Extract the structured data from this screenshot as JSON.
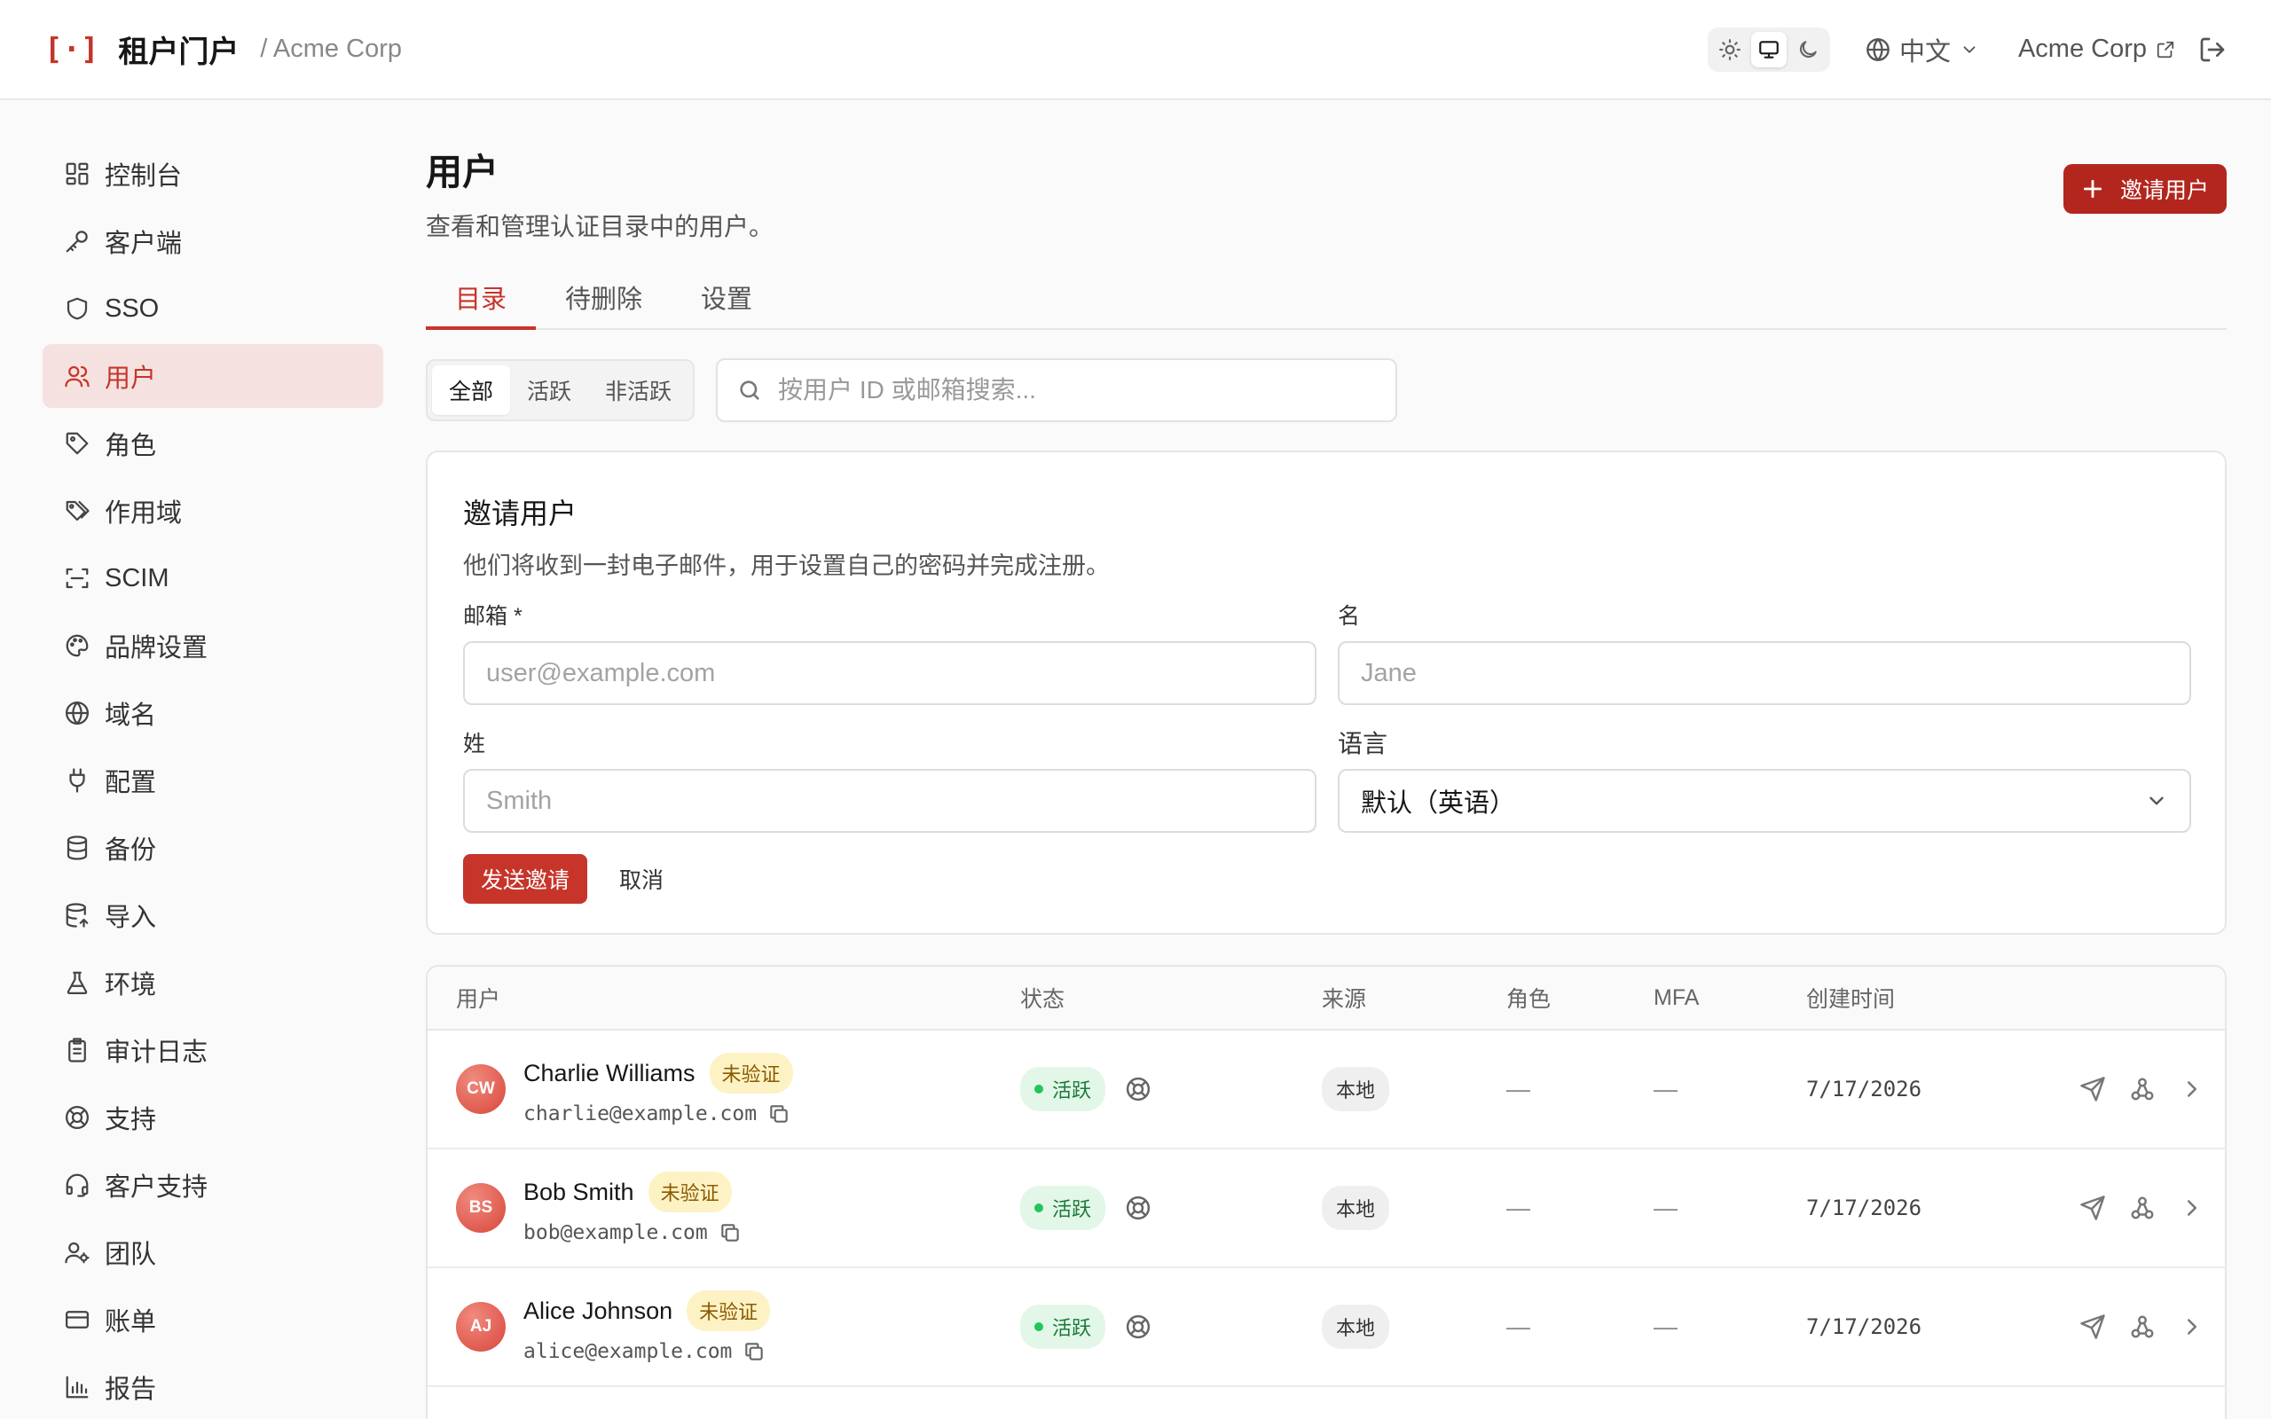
{
  "header": {
    "logo": "[·]",
    "title": "租户门户",
    "org": "/ Acme Corp",
    "language": "中文",
    "org_link": "Acme Corp"
  },
  "sidebar": {
    "items": [
      {
        "label": "控制台",
        "icon": "dashboard-icon"
      },
      {
        "label": "客户端",
        "icon": "key-icon"
      },
      {
        "label": "SSO",
        "icon": "shield-icon"
      },
      {
        "label": "用户",
        "icon": "users-icon"
      },
      {
        "label": "角色",
        "icon": "tag-icon"
      },
      {
        "label": "作用域",
        "icon": "tags-icon"
      },
      {
        "label": "SCIM",
        "icon": "scan-icon"
      },
      {
        "label": "品牌设置",
        "icon": "palette-icon"
      },
      {
        "label": "域名",
        "icon": "globe-icon"
      },
      {
        "label": "配置",
        "icon": "plug-icon"
      },
      {
        "label": "备份",
        "icon": "database-icon"
      },
      {
        "label": "导入",
        "icon": "database-import-icon"
      },
      {
        "label": "环境",
        "icon": "flask-icon"
      },
      {
        "label": "审计日志",
        "icon": "clipboard-icon"
      },
      {
        "label": "支持",
        "icon": "lifebuoy-icon"
      },
      {
        "label": "客户支持",
        "icon": "headset-icon"
      },
      {
        "label": "团队",
        "icon": "user-cog-icon"
      },
      {
        "label": "账单",
        "icon": "credit-card-icon"
      },
      {
        "label": "报告",
        "icon": "bar-chart-icon"
      }
    ],
    "active_index": 3
  },
  "page": {
    "title": "用户",
    "subtitle": "查看和管理认证目录中的用户。",
    "invite_button": "邀请用户"
  },
  "tabs": [
    "目录",
    "待删除",
    "设置"
  ],
  "filters": {
    "segments": [
      "全部",
      "活跃",
      "非活跃"
    ],
    "search_placeholder": "按用户 ID 或邮箱搜索..."
  },
  "invite_form": {
    "title": "邀请用户",
    "description": "他们将收到一封电子邮件，用于设置自己的密码并完成注册。",
    "email_label": "邮箱 *",
    "email_placeholder": "user@example.com",
    "first_name_label": "名",
    "first_name_placeholder": "Jane",
    "last_name_label": "姓",
    "last_name_placeholder": "Smith",
    "language_label": "语言",
    "language_value": "默认（英语）",
    "send_button": "发送邀请",
    "cancel_button": "取消"
  },
  "table": {
    "headers": {
      "user": "用户",
      "status": "状态",
      "source": "来源",
      "role": "角色",
      "mfa": "MFA",
      "created": "创建时间"
    },
    "rows": [
      {
        "initials": "CW",
        "name": "Charlie Williams",
        "badge": "未验证",
        "email": "charlie@example.com",
        "status": "活跃",
        "source": "本地",
        "role": "—",
        "mfa": "—",
        "created": "7/17/2026"
      },
      {
        "initials": "BS",
        "name": "Bob Smith",
        "badge": "未验证",
        "email": "bob@example.com",
        "status": "活跃",
        "source": "本地",
        "role": "—",
        "mfa": "—",
        "created": "7/17/2026"
      },
      {
        "initials": "AJ",
        "name": "Alice Johnson",
        "badge": "未验证",
        "email": "alice@example.com",
        "status": "活跃",
        "source": "本地",
        "role": "—",
        "mfa": "—",
        "created": "7/17/2026"
      }
    ]
  },
  "colors": {
    "accent": "#c7342a",
    "active_bg": "#f5e2e0",
    "status_green": "#22c55e",
    "badge_yellow": "#fdf2c4"
  }
}
